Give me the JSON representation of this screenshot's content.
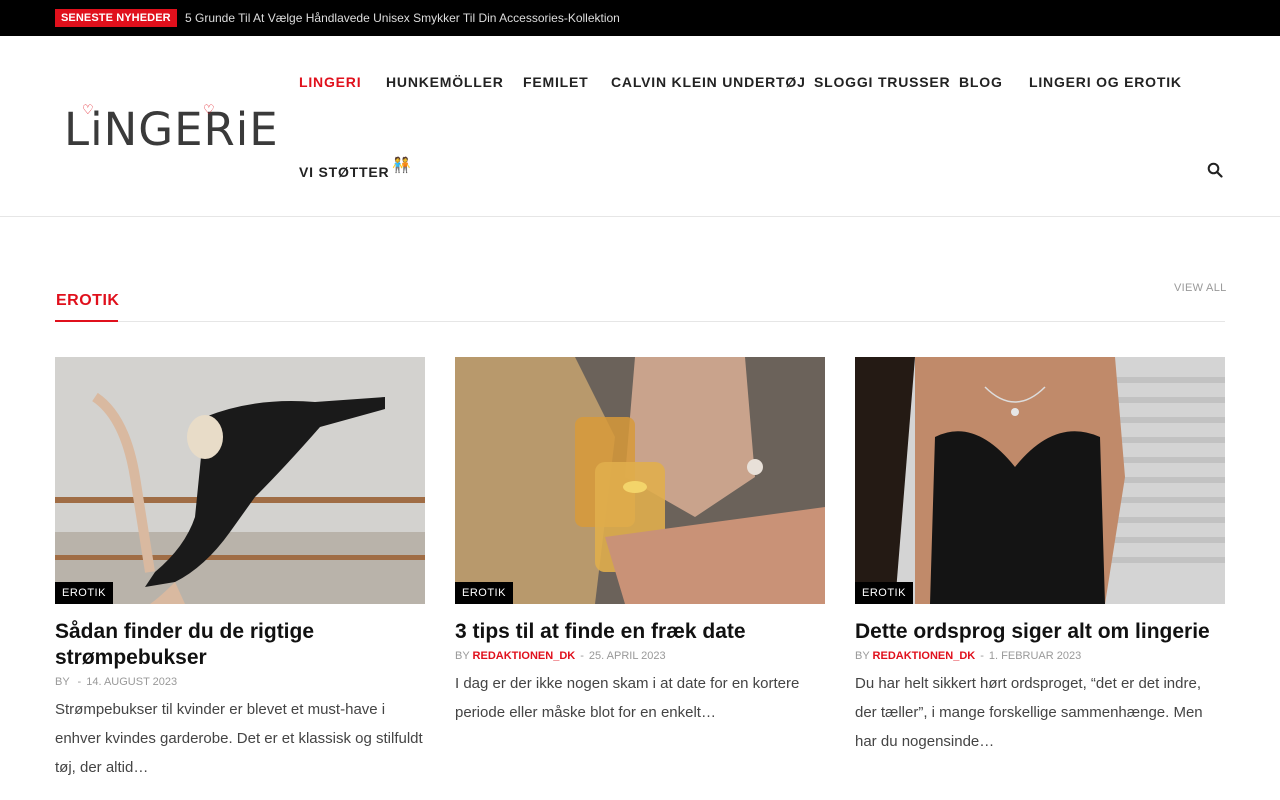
{
  "topbar": {
    "badge": "SENESTE NYHEDER",
    "ticker": "5 Grunde Til At Vælge Håndlavede Unisex Smykker Til Din Accessories-Kollektion"
  },
  "logo": {
    "text": "LiNGERiE",
    "heart": "♡"
  },
  "nav": {
    "items": [
      {
        "label": "LINGERI"
      },
      {
        "label": "HUNKEMÖLLER"
      },
      {
        "label": "FEMILET"
      },
      {
        "label": "CALVIN KLEIN UNDERTØJ"
      },
      {
        "label": "SLOGGI TRUSSER"
      },
      {
        "label": "BLOG"
      },
      {
        "label": "LINGERI OG EROTIK"
      },
      {
        "label": "VI STØTTER"
      }
    ],
    "emoji": "🧑‍🤝‍🧑",
    "search_icon": "search-icon"
  },
  "section": {
    "title": "EROTIK",
    "view_all": "VIEW ALL"
  },
  "cards": [
    {
      "category": "EROTIK",
      "title": "Sådan finder du de rigtige strømpebukser",
      "by": "BY",
      "author": "",
      "date": "14. AUGUST 2023",
      "excerpt": "Strømpebukser til kvinder er blevet et must-have i enhver kvindes garderobe. Det er et klassisk og stilfuldt tøj, der altid…"
    },
    {
      "category": "EROTIK",
      "title": "3 tips til at finde en fræk date",
      "by": "BY",
      "author": "REDAKTIONEN_DK",
      "date": "25. APRIL 2023",
      "excerpt": "I dag er der ikke nogen skam i at date for en kortere periode eller måske blot for en enkelt…"
    },
    {
      "category": "EROTIK",
      "title": "Dette ordsprog siger alt om lingerie",
      "by": "BY",
      "author": "REDAKTIONEN_DK",
      "date": "1. FEBRUAR 2023",
      "excerpt": "Du har helt sikkert hørt ordsproget, “det er det indre, der tæller”, i mange forskellige sammenhænge. Men har du nogensinde…"
    }
  ],
  "colors": {
    "accent": "#e0101c",
    "topbar": "#000000"
  }
}
